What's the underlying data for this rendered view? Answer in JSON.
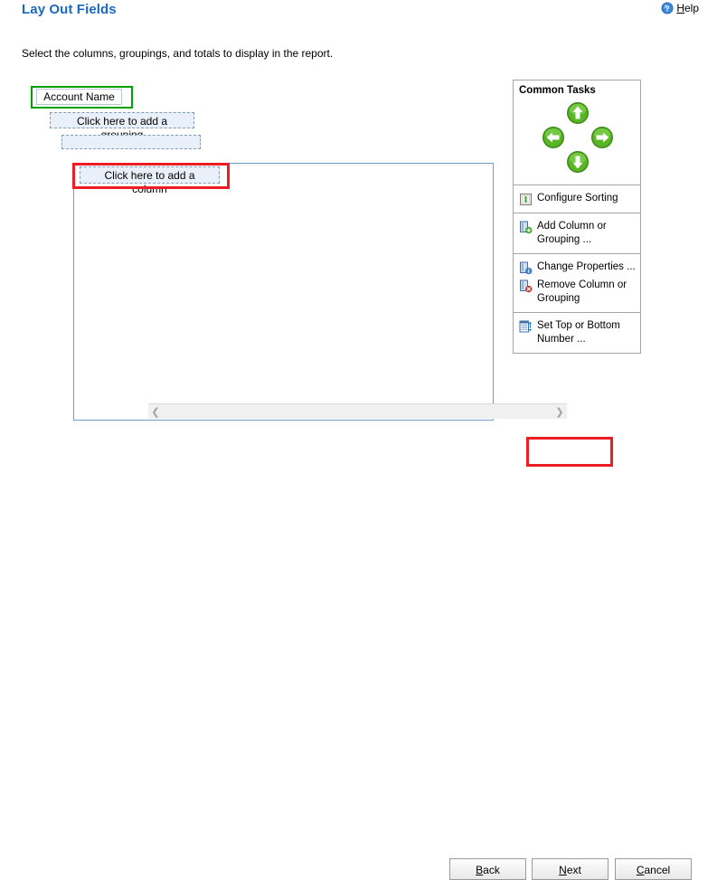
{
  "header": {
    "title": "Lay Out Fields",
    "help_label": "Help",
    "help_access_key": "H",
    "help_icon": "help-circle-icon"
  },
  "subtitle": "Select the columns, groupings, and totals to display in the report.",
  "layout": {
    "account_name_field": "Account Name",
    "add_grouping_placeholder": "Click here to add a grouping",
    "empty_grouping_slot": "",
    "add_column_placeholder": "Click here to add a column",
    "scroll_left_icon": "chevron-left-icon",
    "scroll_right_icon": "chevron-right-icon"
  },
  "common_tasks": {
    "header": "Common Tasks",
    "nav": [
      {
        "name": "move-up-button",
        "icon": "arrow-up-icon"
      },
      {
        "name": "move-left-button",
        "icon": "arrow-left-icon"
      },
      {
        "name": "move-right-button",
        "icon": "arrow-right-icon"
      },
      {
        "name": "move-down-button",
        "icon": "arrow-down-icon"
      }
    ],
    "groups": [
      {
        "items": [
          {
            "label": "Configure Sorting",
            "icon": "sort-icon"
          }
        ]
      },
      {
        "items": [
          {
            "label": "Add Column or Grouping ...",
            "icon": "add-column-icon"
          }
        ]
      },
      {
        "items": [
          {
            "label": "Change Properties ...",
            "icon": "properties-icon"
          },
          {
            "label": "Remove Column or Grouping",
            "icon": "remove-column-icon"
          }
        ]
      },
      {
        "items": [
          {
            "label": "Set Top or Bottom Number ...",
            "icon": "top-bottom-icon"
          }
        ]
      }
    ]
  },
  "footer": {
    "back": {
      "prefix": "",
      "key": "B",
      "suffix": "ack"
    },
    "next": {
      "prefix": "",
      "key": "N",
      "suffix": "ext"
    },
    "cancel": {
      "prefix": "",
      "key": "C",
      "suffix": "ancel"
    }
  },
  "colors": {
    "title_blue": "#1b68c4",
    "annotation_red": "#ee1c25",
    "annotation_green": "#00a000",
    "canvas_border": "#6f9ccc",
    "field_fill": "#e9f0f9",
    "field_dash": "#7f9db9"
  }
}
